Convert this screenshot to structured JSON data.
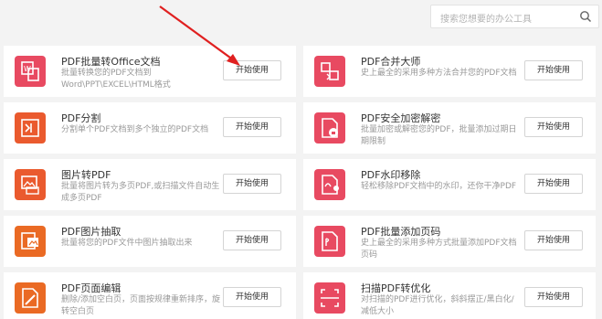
{
  "search": {
    "placeholder": "搜索您想要的办公工具"
  },
  "action_label": "开始使用",
  "tools": [
    {
      "title": "PDF批量转Office文档",
      "desc": "批量转换您的PDF文档到Word\\PPT\\EXCEL\\HTML格式",
      "color": "#e84a61",
      "icon": "pdf-to-office-icon"
    },
    {
      "title": "PDF合并大师",
      "desc": "史上最全的采用多种方法合并您的PDF文档",
      "color": "#e84a61",
      "icon": "pdf-merge-icon"
    },
    {
      "title": "PDF分割",
      "desc": "分割单个PDF文档到多个独立的PDF文档",
      "color": "#ea5a2e",
      "icon": "pdf-split-icon"
    },
    {
      "title": "PDF安全加密解密",
      "desc": "批量加密或解密您的PDF，批量添加过期日期限制",
      "color": "#e84a61",
      "icon": "pdf-encrypt-icon"
    },
    {
      "title": "图片转PDF",
      "desc": "批量将图片转为多页PDF,或扫描文件自动生成多页PDF",
      "color": "#ea5a2e",
      "icon": "image-to-pdf-icon"
    },
    {
      "title": "PDF水印移除",
      "desc": "轻松移除PDF文档中的水印，还你干净PDF",
      "color": "#e84a61",
      "icon": "pdf-watermark-remove-icon"
    },
    {
      "title": "PDF图片抽取",
      "desc": "批量将您的PDF文件中图片抽取出来",
      "color": "#ea6a24",
      "icon": "pdf-image-extract-icon"
    },
    {
      "title": "PDF批量添加页码",
      "desc": "史上最全的采用多种方式批量添加PDF文档页码",
      "color": "#e84a61",
      "icon": "pdf-page-number-icon"
    },
    {
      "title": "PDF页面编辑",
      "desc": "删除/添加空白页，页面按规律重新排序，旋转空白页",
      "color": "#ea6a24",
      "icon": "pdf-page-edit-icon"
    },
    {
      "title": "扫描PDF转优化",
      "desc": "对扫描的PDF进行优化，斜斜摆正/黑白化/减低大小",
      "color": "#e84a61",
      "icon": "scan-pdf-optimize-icon"
    }
  ]
}
